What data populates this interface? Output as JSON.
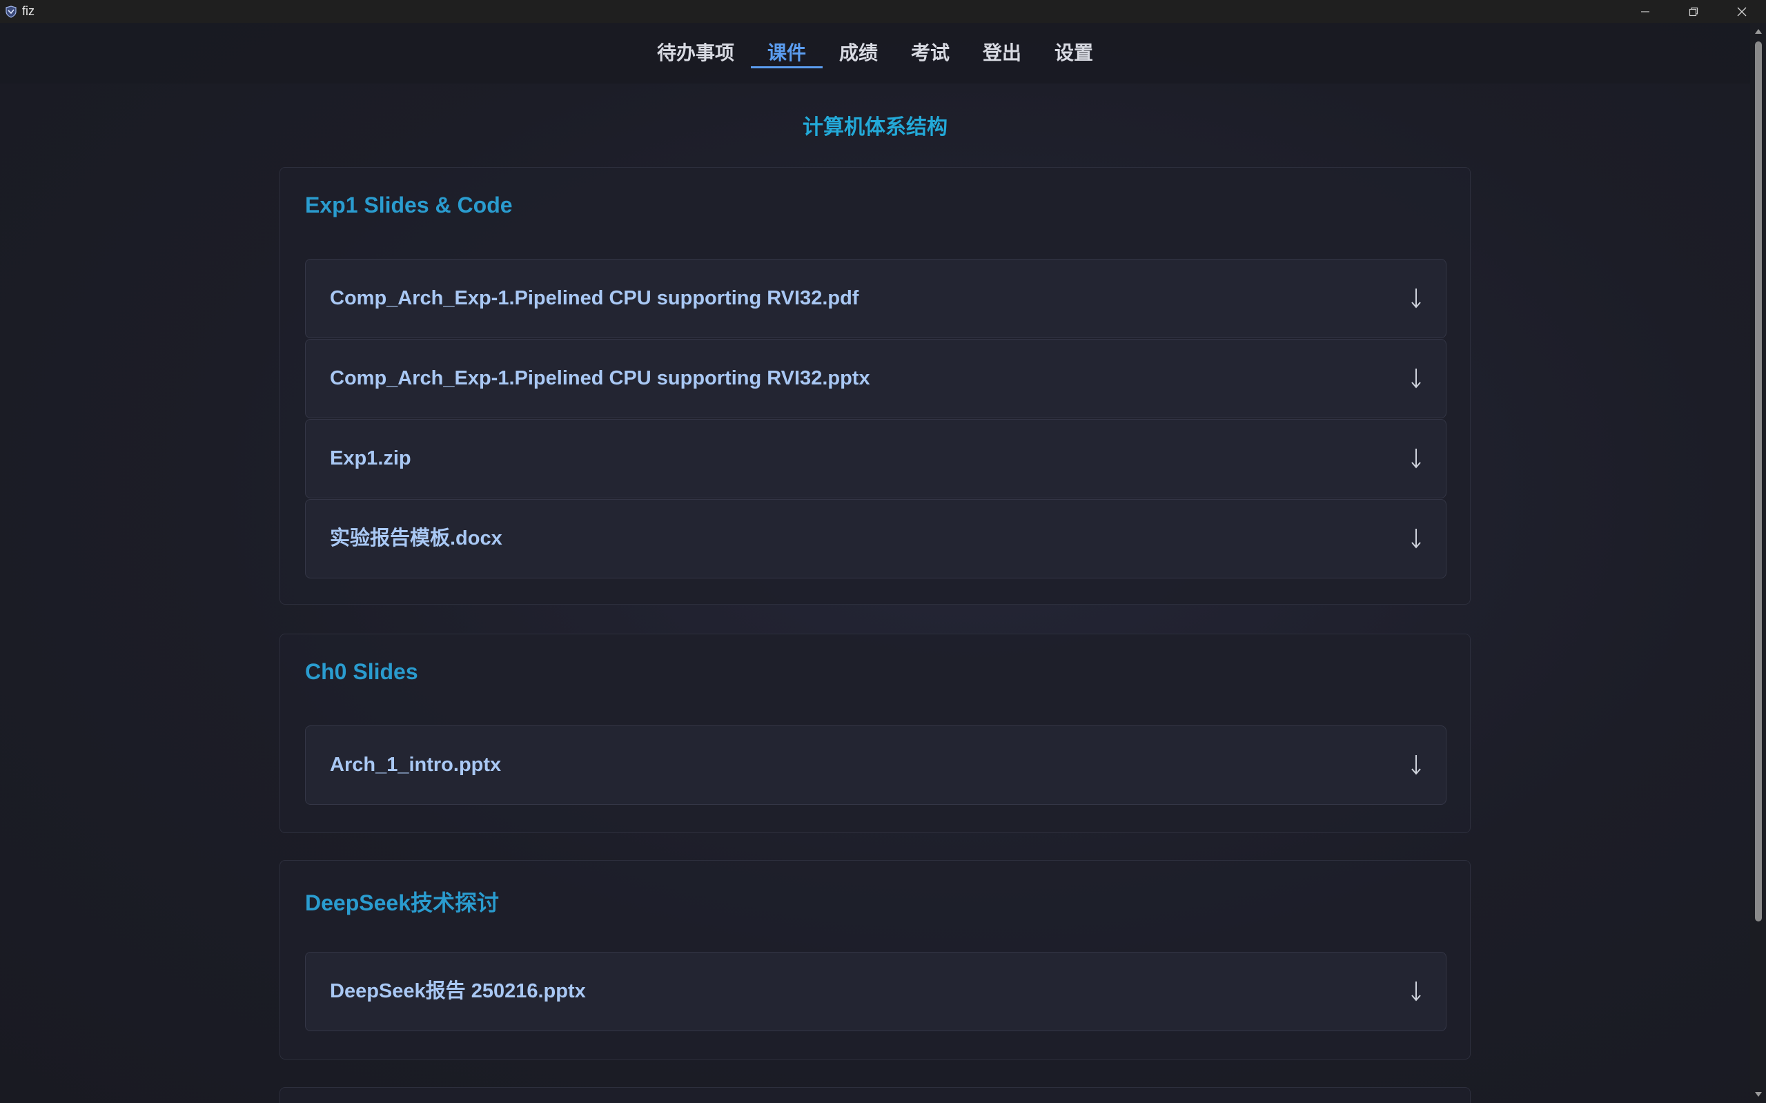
{
  "window": {
    "title": "fiz",
    "icon": "app-logo-icon",
    "controls": [
      "minimize-icon",
      "restore-icon",
      "close-icon"
    ]
  },
  "nav": {
    "tabs": [
      {
        "label": "待办事项",
        "active": false
      },
      {
        "label": "课件",
        "active": true
      },
      {
        "label": "成绩",
        "active": false
      },
      {
        "label": "考试",
        "active": false
      },
      {
        "label": "登出",
        "active": false
      },
      {
        "label": "设置",
        "active": false
      }
    ]
  },
  "course": {
    "title": "计算机体系结构"
  },
  "sections": [
    {
      "title": "Exp1 Slides & Code",
      "files": [
        {
          "name": "Comp_Arch_Exp-1.Pipelined CPU supporting RVI32.pdf",
          "icon": "download-icon"
        },
        {
          "name": "Comp_Arch_Exp-1.Pipelined CPU supporting RVI32.pptx",
          "icon": "download-icon"
        },
        {
          "name": "Exp1.zip",
          "icon": "download-icon"
        },
        {
          "name": "实验报告模板.docx",
          "icon": "download-icon"
        }
      ]
    },
    {
      "title": "Ch0 Slides",
      "files": [
        {
          "name": "Arch_1_intro.pptx",
          "icon": "download-icon"
        }
      ]
    },
    {
      "title": "DeepSeek技术探讨",
      "files": [
        {
          "name": "DeepSeek报告 250216.pptx",
          "icon": "download-icon"
        }
      ]
    }
  ],
  "colors": {
    "accent": "#5b9df0",
    "course_title": "#23a9d8",
    "section_title": "#2a9ccf",
    "file_name": "#a9c8f4"
  }
}
